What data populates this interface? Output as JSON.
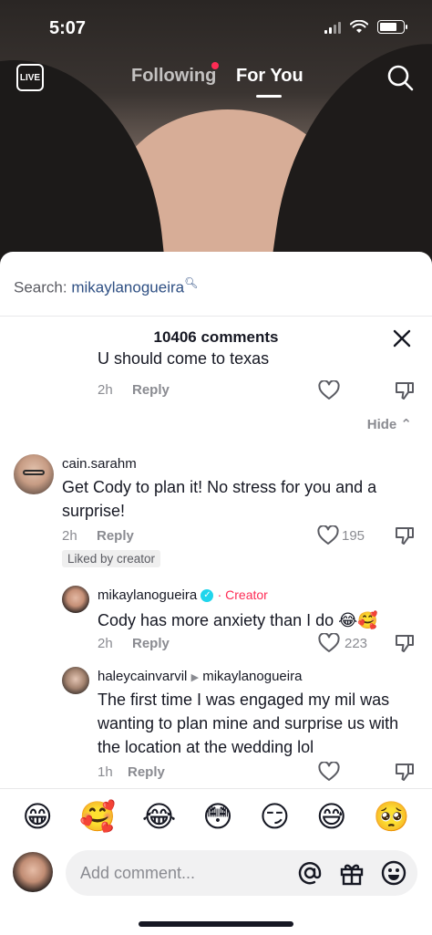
{
  "status_bar": {
    "time": "5:07"
  },
  "top_nav": {
    "live_label": "LIVE",
    "tabs": [
      {
        "label": "Following",
        "has_dot": true
      },
      {
        "label": "For You",
        "active": true
      }
    ],
    "icons": [
      "live-icon",
      "search-icon"
    ]
  },
  "sheet": {
    "search_prefix": "Search: ",
    "search_term": "mikaylanogueira",
    "comment_count_title": "10406 comments",
    "hide_label": "Hide",
    "comments": [
      {
        "text": "U should come to texas",
        "time": "2h",
        "reply_label": "Reply"
      },
      {
        "username": "cain.sarahm",
        "text": "Get Cody to plan it! No stress for you and a surprise!",
        "time": "2h",
        "reply_label": "Reply",
        "likes": "195",
        "liked_by_creator": "Liked by creator",
        "replies": [
          {
            "username": "mikaylanogueira",
            "creator_label": "Creator",
            "text": "Cody has more anxiety than I do 😂🥰",
            "time": "2h",
            "reply_label": "Reply",
            "likes": "223"
          },
          {
            "username": "haleycainvarvil",
            "reply_to": "mikaylanogueira",
            "text": "The first time I was engaged my mil was wanting to plan mine and surprise us with the location at the wedding lol",
            "time": "1h",
            "reply_label": "Reply"
          }
        ]
      }
    ]
  },
  "emoji_bar": [
    "😁",
    "🥰",
    "😂",
    "😳",
    "😏",
    "😅",
    "🥺"
  ],
  "comment_input": {
    "placeholder": "Add comment..."
  },
  "colors": {
    "accent": "#fe2c55",
    "link": "#2e4f83",
    "muted": "#8a8b91"
  }
}
